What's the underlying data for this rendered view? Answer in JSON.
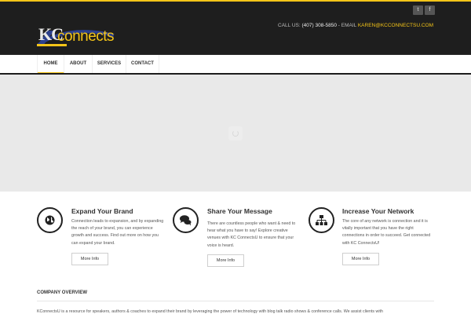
{
  "colors": {
    "accent": "#f5c518",
    "header_bg": "#1e1e1e",
    "slider_bg": "#e9e9e9"
  },
  "header": {
    "social": [
      {
        "name": "twitter-icon",
        "glyph": "t"
      },
      {
        "name": "facebook-icon",
        "glyph": "f"
      }
    ],
    "logo": {
      "kc": "KC",
      "connects": "connects"
    },
    "contact": {
      "call_label": "CALL US:",
      "phone": "(407) 308-5850",
      "separator": " - EMAIL ",
      "email": "KAREN@KCCONNECTSU.COM"
    }
  },
  "nav": {
    "items": [
      {
        "label": "HOME",
        "active": true
      },
      {
        "label": "ABOUT",
        "active": false
      },
      {
        "label": "SERVICES",
        "active": false
      },
      {
        "label": "CONTACT",
        "active": false
      }
    ]
  },
  "features": [
    {
      "icon": "globe-icon",
      "title": "Expand Your Brand",
      "text": "Connection leads to expansion, and by expanding the reach of your brand, you can experience growth and success. Find out more on how you can expand your brand.",
      "button": "More Info"
    },
    {
      "icon": "chat-bubbles-icon",
      "title": "Share Your Message",
      "text": "There are countless people who want & need to hear what you have to say! Explore creative venues with KC ConnectsU to ensure that your voice is heard.",
      "button": "More Info"
    },
    {
      "icon": "network-icon",
      "title": "Increase Your Network",
      "text": "The core of any network is connection and it is vitally important that you have the right connections in order to succeed. Get connected with KC ConnectsU!",
      "button": "More Info"
    }
  ],
  "overview": {
    "title": "COMPANY OVERVIEW",
    "text": "KConnectsU is a resource for speakers, authors & coaches to expand their brand by leveraging the power of technology with blog talk radio shows & conference calls. We assist clients with"
  }
}
